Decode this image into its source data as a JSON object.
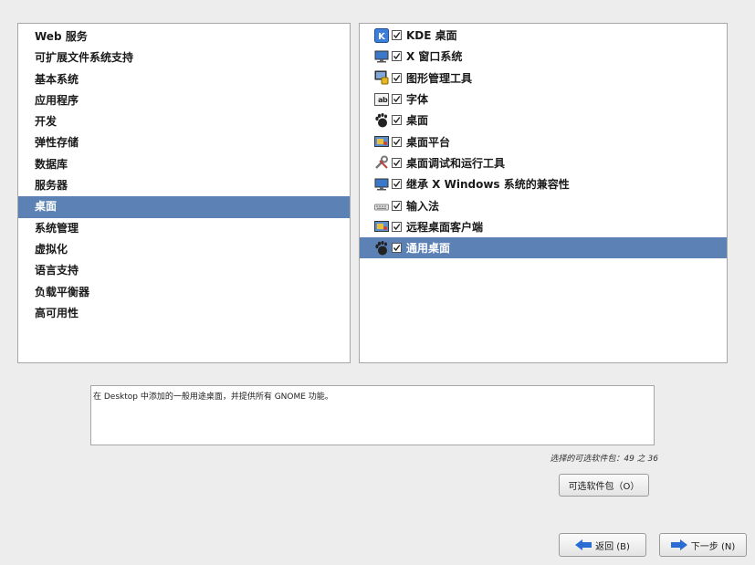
{
  "groups": [
    {
      "label": "Web 服务",
      "selected": false
    },
    {
      "label": "可扩展文件系统支持",
      "selected": false
    },
    {
      "label": "基本系统",
      "selected": false
    },
    {
      "label": "应用程序",
      "selected": false
    },
    {
      "label": "开发",
      "selected": false
    },
    {
      "label": "弹性存储",
      "selected": false
    },
    {
      "label": "数据库",
      "selected": false
    },
    {
      "label": "服务器",
      "selected": false
    },
    {
      "label": "桌面",
      "selected": true
    },
    {
      "label": "系统管理",
      "selected": false
    },
    {
      "label": "虚拟化",
      "selected": false
    },
    {
      "label": "语言支持",
      "selected": false
    },
    {
      "label": "负载平衡器",
      "selected": false
    },
    {
      "label": "高可用性",
      "selected": false
    }
  ],
  "packages": [
    {
      "label": "KDE 桌面",
      "icon": "kde-icon",
      "checked": true,
      "selected": false
    },
    {
      "label": "X 窗口系统",
      "icon": "monitor-icon",
      "checked": true,
      "selected": false
    },
    {
      "label": "图形管理工具",
      "icon": "admin-lock-icon",
      "checked": true,
      "selected": false
    },
    {
      "label": "字体",
      "icon": "font-icon",
      "checked": true,
      "selected": false
    },
    {
      "label": "桌面",
      "icon": "gnome-foot-icon",
      "checked": true,
      "selected": false
    },
    {
      "label": "桌面平台",
      "icon": "desktop-platform-icon",
      "checked": true,
      "selected": false
    },
    {
      "label": "桌面调试和运行工具",
      "icon": "tools-icon",
      "checked": true,
      "selected": false
    },
    {
      "label": "继承 X Windows 系统的兼容性",
      "icon": "monitor-icon",
      "checked": true,
      "selected": false
    },
    {
      "label": "输入法",
      "icon": "keyboard-icon",
      "checked": true,
      "selected": false
    },
    {
      "label": "远程桌面客户端",
      "icon": "desktop-platform-icon",
      "checked": true,
      "selected": false
    },
    {
      "label": "通用桌面",
      "icon": "gnome-foot-icon",
      "checked": true,
      "selected": true
    }
  ],
  "description": "在 Desktop 中添加的一般用途桌面，并提供所有 GNOME 功能。",
  "count_text": "选择的可选软件包：49 之 36",
  "buttons": {
    "optional": "可选软件包（O）",
    "back": "返回 (B)",
    "next": "下一步 (N)"
  },
  "colors": {
    "selection": "#5c82b5",
    "arrow": "#2b6cd4"
  }
}
